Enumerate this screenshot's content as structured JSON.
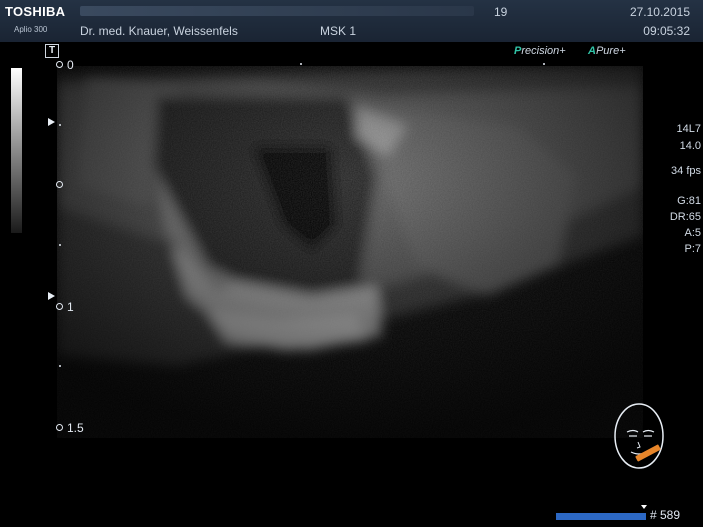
{
  "header": {
    "brand": "TOSHIBA",
    "model": "Aplio 300",
    "counter": "19",
    "date": "27.10.2015",
    "time": "09:05:32",
    "doctor": "Dr. med. Knauer, Weissenfels",
    "preset": "MSK 1"
  },
  "overlay": {
    "t_label": "T",
    "precision_prefix": "P",
    "precision_label": "recision+",
    "pure_prefix": "A",
    "pure_label": "Pure+"
  },
  "depth_scale": {
    "labels": [
      "0",
      "1",
      "1.5"
    ]
  },
  "params": {
    "probe": "14L7",
    "freq": "14.0",
    "fps": "34 fps",
    "gain": "G:81",
    "dr": "DR:65",
    "a": "A:5",
    "p": "P:7"
  },
  "footer": {
    "frame_number": "# 589",
    "progress_fraction": 0.98
  },
  "colors": {
    "header_bg": "#1f2b3b",
    "accent_teal": "#31c4a7",
    "progress_blue": "#2c68c4",
    "probe_orange": "#e8862a"
  },
  "icons": {
    "body_mark": "face-body-mark-icon",
    "t_icon": "t-icon"
  }
}
